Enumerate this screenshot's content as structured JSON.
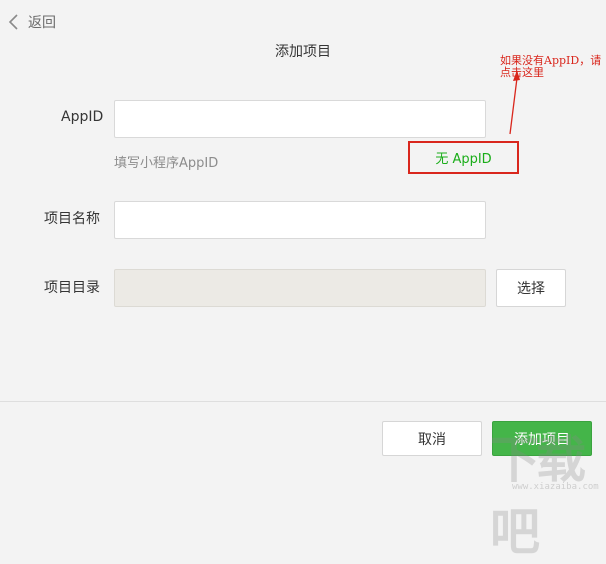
{
  "header": {
    "back_label": "返回",
    "title": "添加项目"
  },
  "form": {
    "appid": {
      "label": "AppID",
      "value": "",
      "hint": "填写小程序AppID",
      "no_appid_link": "无 AppID"
    },
    "project_name": {
      "label": "项目名称",
      "value": ""
    },
    "project_dir": {
      "label": "项目目录",
      "value": "",
      "choose_label": "选择"
    }
  },
  "annotation": {
    "text": "如果没有AppID，请点击这里",
    "color": "#d9261c"
  },
  "footer": {
    "cancel_label": "取消",
    "add_label": "添加项目"
  },
  "watermark": {
    "text": "下载吧",
    "url": "www.xiazaiba.com"
  },
  "colors": {
    "accent_green": "#44b549",
    "link_green": "#1aad19",
    "annotation_red": "#d9261c",
    "background": "#f3f3f3"
  },
  "icons": {
    "back": "chevron-left-icon"
  }
}
